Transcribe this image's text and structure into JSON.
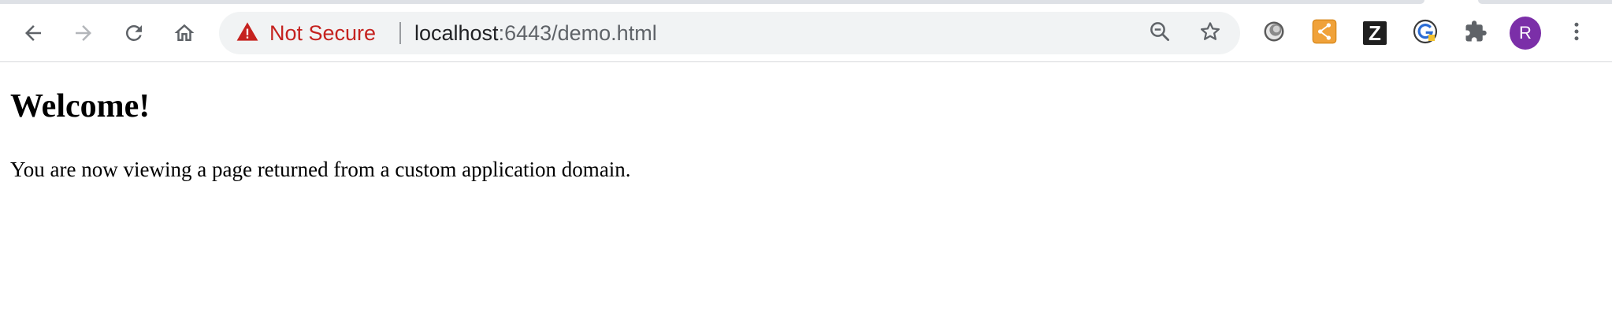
{
  "toolbar": {
    "nav": {
      "back_icon": "arrow-left-icon",
      "forward_icon": "arrow-right-icon",
      "reload_icon": "reload-icon",
      "home_icon": "home-icon"
    },
    "omnibox": {
      "security_icon": "warning-triangle-icon",
      "security_text": "Not Secure",
      "url_host": "localhost",
      "url_rest": ":6443/demo.html",
      "zoom_icon": "zoom-out-icon",
      "bookmark_icon": "star-icon"
    },
    "extensions": {
      "items": [
        {
          "icon": "circle-orb-extension-icon"
        },
        {
          "icon": "orange-share-extension-icon"
        },
        {
          "icon": "z-extension-icon",
          "label": "Z"
        },
        {
          "icon": "g-circle-extension-icon"
        },
        {
          "icon": "puzzle-piece-icon"
        }
      ],
      "profile_initial": "R",
      "menu_icon": "kebab-menu-icon"
    }
  },
  "colors": {
    "warning_red": "#c5221f",
    "avatar_purple": "#7b2fa8",
    "omnibox_bg": "#f1f3f4"
  },
  "page": {
    "heading": "Welcome!",
    "body": "You are now viewing a page returned from a custom application domain."
  }
}
